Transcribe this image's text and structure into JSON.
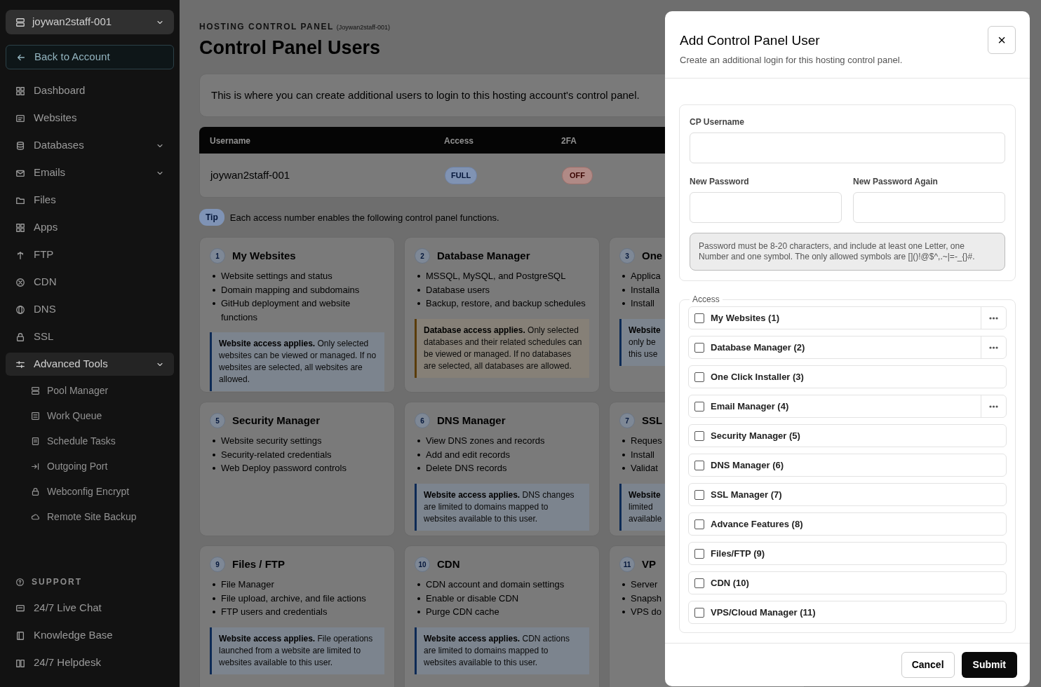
{
  "sidebar": {
    "account": "joywan2staff-001",
    "back": "Back to Account",
    "items": [
      {
        "label": "Dashboard"
      },
      {
        "label": "Websites"
      },
      {
        "label": "Databases",
        "expanded": false
      },
      {
        "label": "Emails",
        "expanded": false
      },
      {
        "label": "Files"
      },
      {
        "label": "Apps"
      },
      {
        "label": "FTP"
      },
      {
        "label": "CDN"
      },
      {
        "label": "DNS"
      },
      {
        "label": "SSL"
      },
      {
        "label": "Advanced Tools",
        "expanded": true,
        "children": [
          {
            "label": "Pool Manager"
          },
          {
            "label": "Work Queue"
          },
          {
            "label": "Schedule Tasks"
          },
          {
            "label": "Outgoing Port"
          },
          {
            "label": "Webconfig Encrypt"
          },
          {
            "label": "Remote Site Backup"
          }
        ]
      }
    ],
    "support": {
      "title": "SUPPORT",
      "items": [
        {
          "label": "24/7 Live Chat"
        },
        {
          "label": "Knowledge Base"
        },
        {
          "label": "24/7 Helpdesk"
        }
      ]
    }
  },
  "main": {
    "eyebrow": "HOSTING CONTROL PANEL",
    "account_note": "(Joywan2staff-001)",
    "title": "Control Panel Users",
    "intro": "This is where you can create additional users to login to this hosting account's control panel.",
    "table": {
      "columns": [
        "Username",
        "Access",
        "2FA"
      ],
      "rows": [
        {
          "username": "joywan2staff-001",
          "access": "FULL",
          "two_fa": "OFF"
        }
      ]
    },
    "tip": {
      "badge": "Tip",
      "text": "Each access number enables the following control panel functions."
    },
    "cards": [
      {
        "number": "1",
        "title": "My Websites",
        "items": [
          "Website settings and status",
          "Domain mapping and subdomains",
          "GitHub deployment and website functions"
        ],
        "note": {
          "kind": "website",
          "text": "**Website access applies.** Only selected websites can be viewed or managed. If no websites are selected, all websites are allowed."
        }
      },
      {
        "number": "2",
        "title": "Database Manager",
        "items": [
          "MSSQL, MySQL, and PostgreSQL",
          "Database users",
          "Backup, restore, and backup schedules"
        ],
        "note": {
          "kind": "database",
          "text": "**Database access applies.** Only selected databases and their related schedules can be viewed or managed. If no databases are selected, all databases are allowed."
        }
      },
      {
        "number": "3",
        "title": "One",
        "items": [
          "Applica",
          "Installa",
          "Install"
        ],
        "note": {
          "kind": "website",
          "lines": [
            "**Website**",
            "only be",
            "this use"
          ]
        }
      },
      {
        "number": "5",
        "title": "Security Manager",
        "items": [
          "Website security settings",
          "Security-related credentials",
          "Web Deploy password controls"
        ]
      },
      {
        "number": "6",
        "title": "DNS Manager",
        "items": [
          "View DNS zones and records",
          "Add and edit records",
          "Delete DNS records"
        ],
        "note": {
          "kind": "website",
          "text": "**Website access applies.** DNS changes are limited to domains mapped to websites available to this user."
        }
      },
      {
        "number": "7",
        "title": "SSL",
        "items": [
          "Reques",
          "Install",
          "Validat"
        ],
        "note": {
          "kind": "website",
          "lines": [
            "**Website**",
            "limited",
            "available"
          ]
        }
      },
      {
        "number": "9",
        "title": "Files / FTP",
        "items": [
          "File Manager",
          "File upload, archive, and file actions",
          "FTP users and credentials"
        ],
        "note": {
          "kind": "website",
          "text": "**Website access applies.** File operations launched from a website are limited to websites available to this user."
        }
      },
      {
        "number": "10",
        "title": "CDN",
        "items": [
          "CDN account and domain settings",
          "Enable or disable CDN",
          "Purge CDN cache"
        ],
        "note": {
          "kind": "website",
          "text": "**Website access applies.** CDN actions are limited to domains mapped to websites available to this user."
        }
      },
      {
        "number": "11",
        "title": "VP",
        "items": [
          "Server",
          "Snapsh",
          "VPS do"
        ]
      }
    ]
  },
  "modal": {
    "title": "Add Control Panel User",
    "subtitle": "Create an additional login for this hosting control panel.",
    "close": "×",
    "field_rows": [
      [
        {
          "label": "CP Username"
        }
      ],
      [
        {
          "label": "New Password"
        },
        {
          "label": "New Password Again"
        }
      ]
    ],
    "hint": "Password must be 8-20 characters, and include at least one Letter, one Number and one symbol. The only allowed symbols are []()!@$^,.~|=-_{}#.",
    "access": {
      "legend": "Access",
      "options": [
        {
          "label": "My Websites (1)",
          "checked": false,
          "expandable": true
        },
        {
          "label": "Database Manager (2)",
          "checked": false,
          "expandable": true
        },
        {
          "label": "One Click Installer (3)",
          "checked": false,
          "expandable": false
        },
        {
          "label": "Email Manager (4)",
          "checked": false,
          "expandable": true
        },
        {
          "label": "Security Manager (5)",
          "checked": false,
          "expandable": false
        },
        {
          "label": "DNS Manager (6)",
          "checked": false,
          "expandable": false
        },
        {
          "label": "SSL Manager (7)",
          "checked": false,
          "expandable": false
        },
        {
          "label": "Advance Features (8)",
          "checked": false,
          "expandable": false
        },
        {
          "label": "Files/FTP (9)",
          "checked": false,
          "expandable": false
        },
        {
          "label": "CDN (10)",
          "checked": false,
          "expandable": false
        },
        {
          "label": "VPS/Cloud Manager (11)",
          "checked": false,
          "expandable": false
        }
      ]
    },
    "buttons": {
      "cancel": "Cancel",
      "submit": "Submit"
    }
  }
}
